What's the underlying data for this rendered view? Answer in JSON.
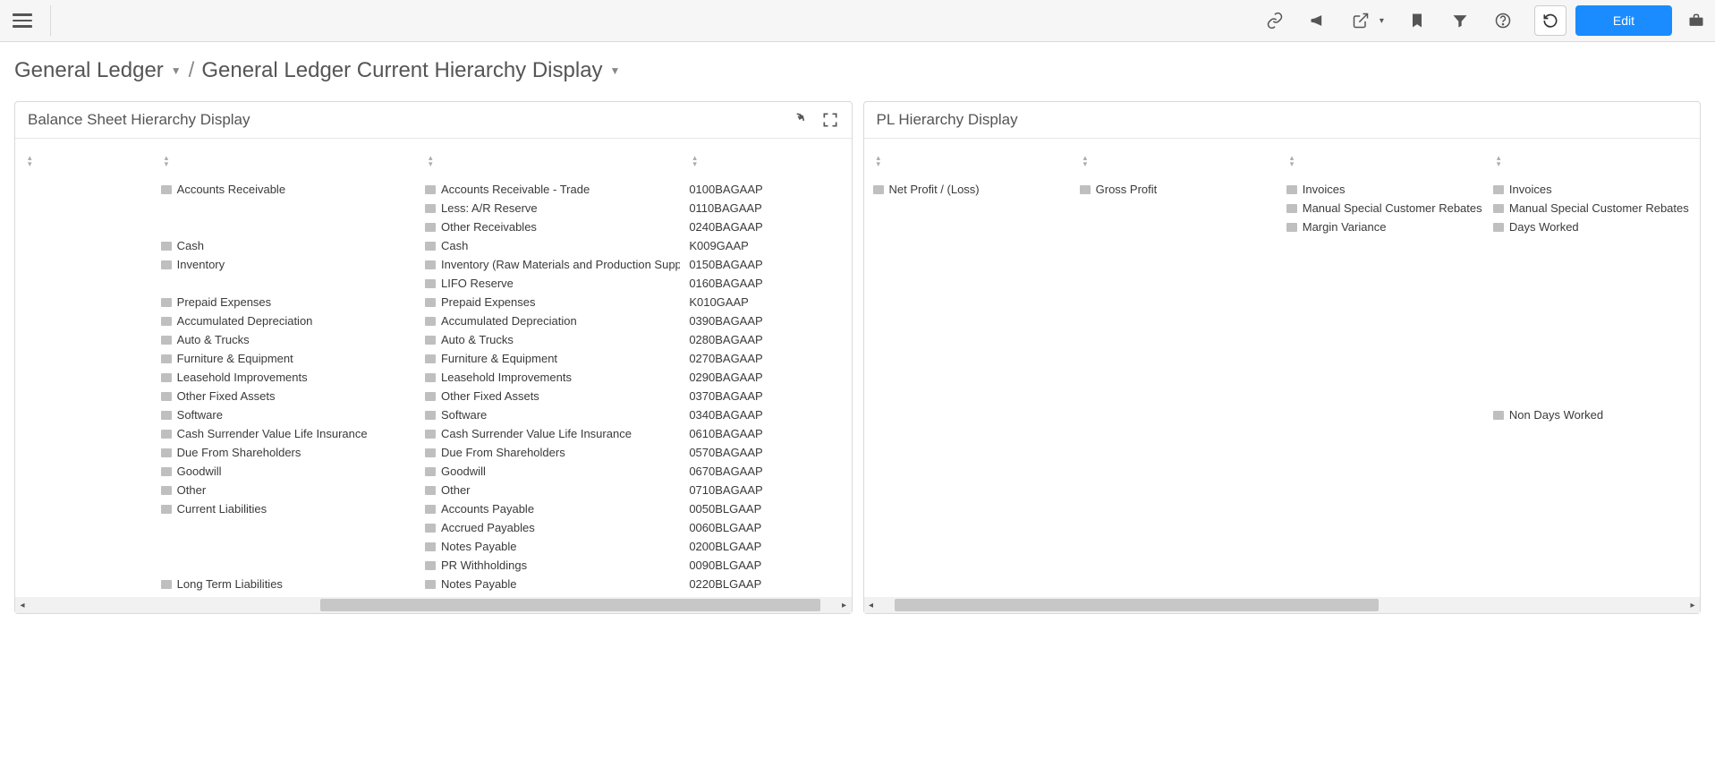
{
  "toolbar": {
    "edit_label": "Edit"
  },
  "breadcrumb": {
    "root": "General Ledger",
    "separator": "/",
    "page": "General Ledger Current Hierarchy Display"
  },
  "panels": {
    "balance_sheet": {
      "title": "Balance Sheet Hierarchy Display",
      "col1_empty_placeholder": "",
      "col2": [
        "Accounts Receivable",
        "",
        "",
        "Cash",
        "Inventory",
        "",
        "Prepaid Expenses",
        "Accumulated Depreciation",
        "Auto & Trucks",
        "Furniture & Equipment",
        "Leasehold Improvements",
        "Other Fixed Assets",
        "Software",
        "Cash Surrender Value Life Insurance",
        "Due From Shareholders",
        "Goodwill",
        "Other",
        "Current Liabilities",
        "",
        "",
        "",
        "Long Term Liabilities"
      ],
      "col3": [
        "Accounts Receivable - Trade",
        "Less: A/R Reserve",
        "Other Receivables",
        "Cash",
        "Inventory (Raw Materials and Production Supply)",
        "LIFO Reserve",
        "Prepaid Expenses",
        "Accumulated Depreciation",
        "Auto & Trucks",
        "Furniture & Equipment",
        "Leasehold Improvements",
        "Other Fixed Assets",
        "Software",
        "Cash Surrender Value Life Insurance",
        "Due From Shareholders",
        "Goodwill",
        "Other",
        "Accounts Payable",
        "Accrued Payables",
        "Notes Payable",
        "PR Withholdings",
        "Notes Payable"
      ],
      "col4": [
        "0100BAGAAP",
        "0110BAGAAP",
        "0240BAGAAP",
        "K009GAAP",
        "0150BAGAAP",
        "0160BAGAAP",
        "K010GAAP",
        "0390BAGAAP",
        "0280BAGAAP",
        "0270BAGAAP",
        "0290BAGAAP",
        "0370BAGAAP",
        "0340BAGAAP",
        "0610BAGAAP",
        "0570BAGAAP",
        "0670BAGAAP",
        "0710BAGAAP",
        "0050BLGAAP",
        "0060BLGAAP",
        "0200BLGAAP",
        "0090BLGAAP",
        "0220BLGAAP"
      ]
    },
    "pl": {
      "title": "PL Hierarchy Display",
      "col1": [
        "Net Profit / (Loss)"
      ],
      "col2": [
        "Gross Profit"
      ],
      "col3": [
        "Invoices",
        "Manual Special Customer Rebates",
        "Margin Variance"
      ],
      "col4": [
        "Invoices",
        "Manual Special Customer Rebates",
        "Days Worked",
        "",
        "",
        "",
        "",
        "",
        "",
        "",
        "",
        "",
        "Non Days Worked"
      ]
    }
  }
}
